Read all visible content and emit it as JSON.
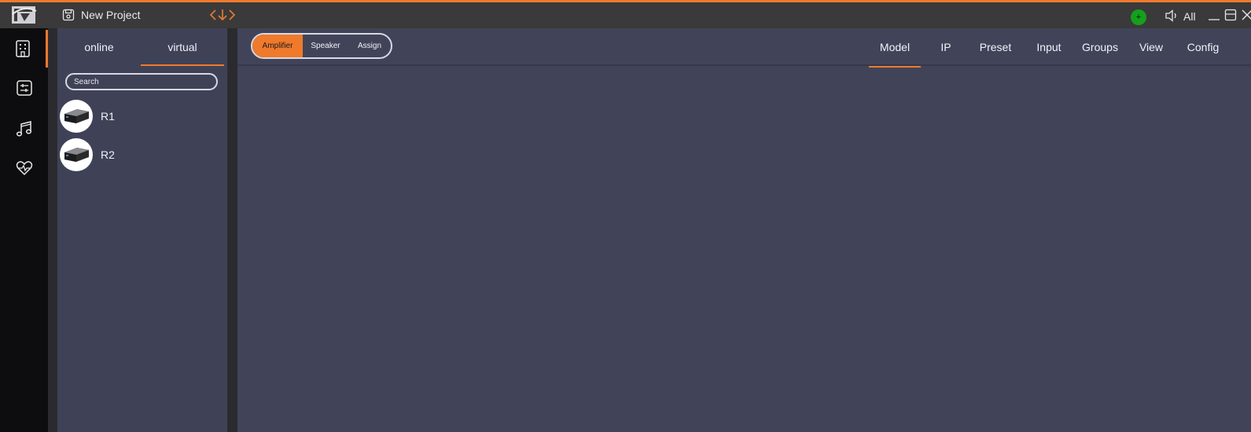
{
  "titlebar": {
    "project_name": "New Project",
    "volume_label": "All",
    "status_symbol": "+"
  },
  "rail": {
    "items": [
      {
        "icon": "building-icon",
        "active": true
      },
      {
        "icon": "mixer-icon",
        "active": false
      },
      {
        "icon": "music-note-icon",
        "active": false
      },
      {
        "icon": "heart-pulse-icon",
        "active": false
      }
    ]
  },
  "device_panel": {
    "tabs": [
      {
        "label": "online",
        "active": false
      },
      {
        "label": "virtual",
        "active": true
      }
    ],
    "search_placeholder": "Search",
    "devices": [
      {
        "label": "R1"
      },
      {
        "label": "R2"
      }
    ]
  },
  "main": {
    "segments": [
      {
        "label": "Amplifier",
        "active": true
      },
      {
        "label": "Speaker",
        "active": false
      },
      {
        "label": "Assign",
        "active": false
      }
    ],
    "tabs": [
      {
        "label": "Model",
        "active": true
      },
      {
        "label": "IP",
        "active": false
      },
      {
        "label": "Preset",
        "active": false
      },
      {
        "label": "Input",
        "active": false
      },
      {
        "label": "Groups",
        "active": false
      },
      {
        "label": "View",
        "active": false
      },
      {
        "label": "Config",
        "active": false
      }
    ]
  },
  "colors": {
    "accent": "#ef7a2c",
    "status_online": "#14a01c",
    "panel_bg": "#3f4257",
    "main_bg": "#414459"
  }
}
